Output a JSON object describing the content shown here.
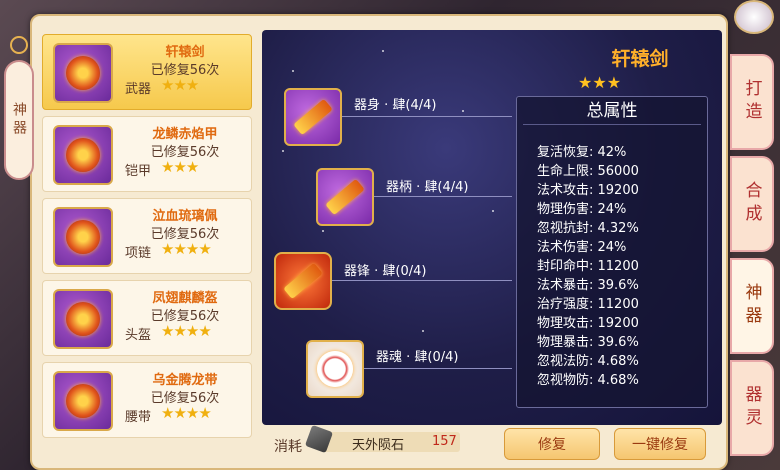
{
  "sidebar_tab": {
    "label": "神器"
  },
  "items": [
    {
      "name": "轩辕剑",
      "repair": "已修复56次",
      "type": "武器",
      "stars": "★★★",
      "selected": true
    },
    {
      "name": "龙鳞赤焰甲",
      "repair": "已修复56次",
      "type": "铠甲",
      "stars": "★★★",
      "selected": false
    },
    {
      "name": "泣血琉璃佩",
      "repair": "已修复56次",
      "type": "项链",
      "stars": "★★★★",
      "selected": false
    },
    {
      "name": "凤翅麒麟盔",
      "repair": "已修复56次",
      "type": "头盔",
      "stars": "★★★★",
      "selected": false
    },
    {
      "name": "乌金腾龙带",
      "repair": "已修复56次",
      "type": "腰带",
      "stars": "★★★★",
      "selected": false
    }
  ],
  "detail": {
    "title": "轩辕剑",
    "stars": "★★★",
    "parts": [
      {
        "label": "器身 · 肆(4/4)"
      },
      {
        "label": "器柄 · 肆(4/4)"
      },
      {
        "label": "器锋 · 肆(0/4)"
      },
      {
        "label": "器魂 · 肆(0/4)"
      }
    ],
    "attr_title": "总属性",
    "attrs": [
      "复活恢复: 42%",
      "生命上限: 56000",
      "法术攻击: 19200",
      "物理伤害: 24%",
      "忽视抗封: 4.32%",
      "法术伤害: 24%",
      "封印命中: 11200",
      "法术暴击: 39.6%",
      "治疗强度: 11200",
      "物理攻击: 19200",
      "物理暴击: 39.6%",
      "忽视法防: 4.68%",
      "忽视物防: 4.68%"
    ]
  },
  "footer": {
    "cost_label": "消耗",
    "cost_item": "天外陨石",
    "cost_value": "157",
    "repair_btn": "修复",
    "repair_all_btn": "一键修复"
  },
  "right_tabs": [
    {
      "label": "打造"
    },
    {
      "label": "合成"
    },
    {
      "label": "神器"
    },
    {
      "label": "器灵"
    }
  ]
}
